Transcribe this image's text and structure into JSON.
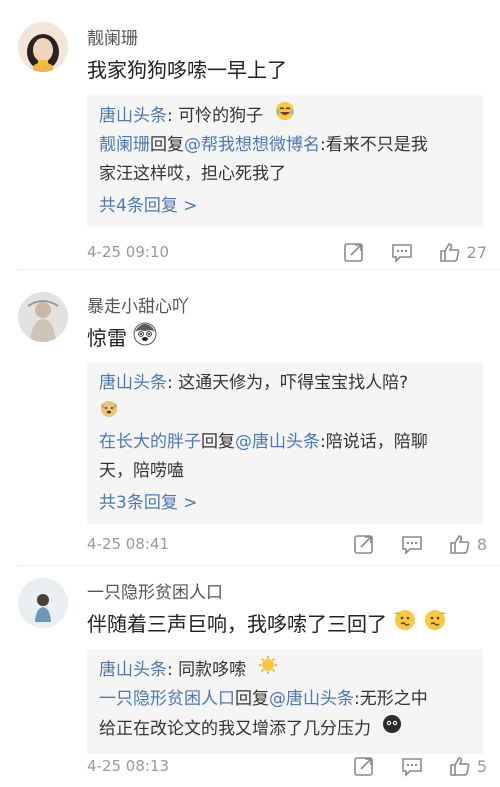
{
  "comments": [
    {
      "user": "靓阑珊",
      "text": "我家狗狗哆嗦一早上了",
      "text_emoji": [],
      "replies": [
        {
          "author": "唐山头条",
          "sep": ": ",
          "body": "可怜的狗子",
          "emoji": "laugh-cry-emoji"
        },
        {
          "author": "靓阑珊",
          "verb": "回复",
          "mention": "@帮我想想微博名",
          "sep": ":",
          "body1": "看来不只是我",
          "body2": "家汪这样哎，担心死我了"
        }
      ],
      "more_label": "共4条回复 >",
      "time": "4-25 09:10",
      "likes": "27"
    },
    {
      "user": "暴走小甜心吖",
      "text": "惊雷",
      "text_emoji": [
        "husky-emoji"
      ],
      "replies": [
        {
          "author": "唐山头条",
          "sep": ": ",
          "body1": "这通天修为，吓得宝宝找人陪?",
          "emoji": "dog-emoji"
        },
        {
          "author": "在长大的胖子",
          "verb": "回复",
          "mention": "@唐山头条",
          "sep": ":",
          "body1": "陪说话，陪聊",
          "body2": "天，陪唠嗑"
        }
      ],
      "more_label": "共3条回复 >",
      "time": "4-25 08:41",
      "likes": "8"
    },
    {
      "user": "一只隐形贫困人口",
      "text": "伴随着三声巨响，我哆嗦了三回了",
      "text_emoji": [
        "shiver-emoji",
        "shiver-emoji"
      ],
      "replies": [
        {
          "author": "唐山头条",
          "sep": ": ",
          "body": "同款哆嗦",
          "emoji": "sun-emoji"
        },
        {
          "author": "一只隐形贫困人口",
          "verb": "回复",
          "mention": "@唐山头条",
          "sep": ":",
          "body1": "无形之中",
          "body2": "给正在改论文的我又增添了几分压力",
          "emoji": "black-face-emoji"
        }
      ],
      "time": "4-25 08:13",
      "likes": "5"
    }
  ],
  "icons": {
    "forward": "forward-icon",
    "comment": "comment-icon",
    "like": "thumb-up-icon"
  },
  "colors": {
    "link_blue": "#4d78b1",
    "reply_bg": "#f5f5f5",
    "meta_gray": "#999999"
  }
}
